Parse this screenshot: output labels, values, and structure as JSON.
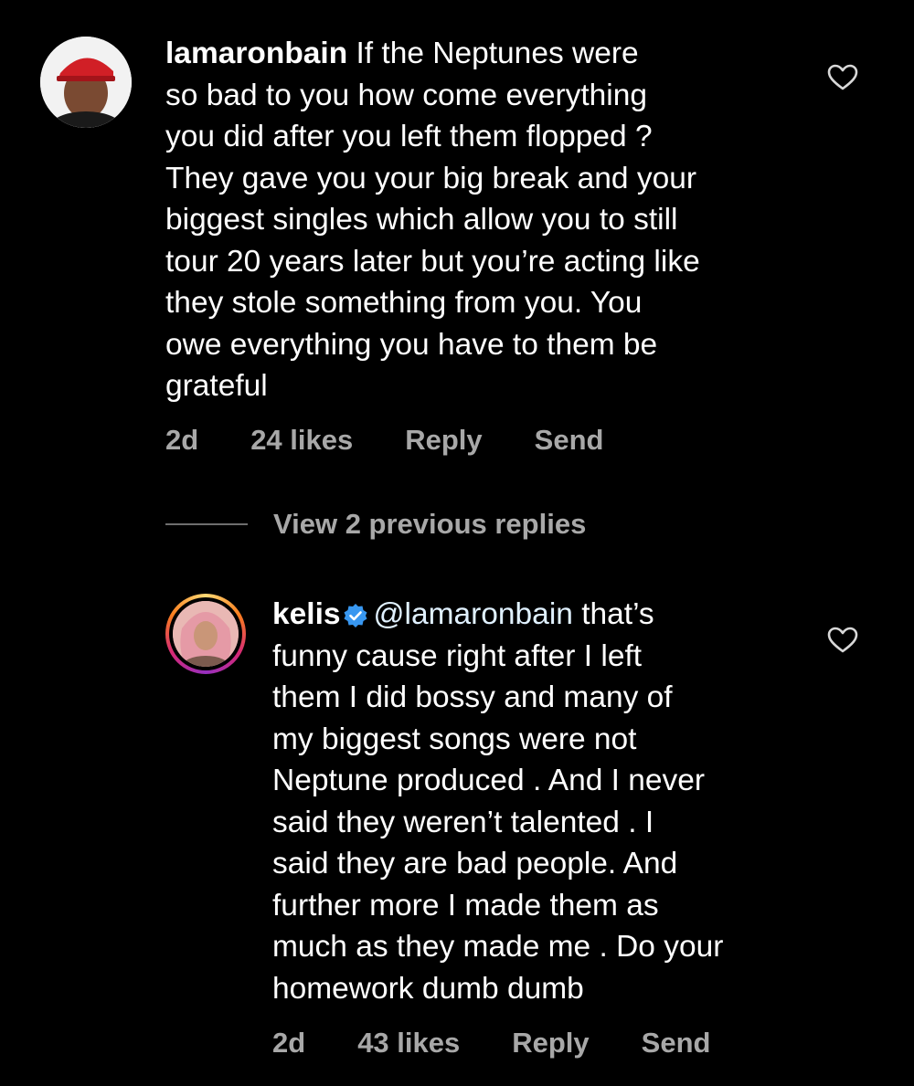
{
  "comments": [
    {
      "username": "lamaronbain",
      "verified": false,
      "text": " If the Neptunes were\nso bad to you how come everything\nyou did after you left them flopped ?\nThey gave you your big break and your\nbiggest singles which allow you to still\ntour 20 years later but you’re acting like\nthey stole something from you. You\nowe everything you have to them be\ngrateful",
      "time": "2d",
      "likes": "24 likes",
      "reply_label": "Reply",
      "send_label": "Send",
      "avatar_icon": "user-avatar-red-cap"
    },
    {
      "username": "kelis",
      "verified": true,
      "mention": "@lamaronbain",
      "text": " that’s\nfunny cause right after I left\nthem I did bossy and many of\nmy biggest songs were not\nNeptune produced . And I never\nsaid they weren’t talented . I\nsaid they are bad people. And\nfurther more I made them as\nmuch as they made me . Do your\nhomework dumb dumb",
      "time": "2d",
      "likes": "43 likes",
      "reply_label": "Reply",
      "send_label": "Send",
      "avatar_icon": "user-avatar-story-ring"
    }
  ],
  "view_replies_label": "View 2 previous replies",
  "colors": {
    "background": "#000000",
    "text": "#ffffff",
    "meta": "#a8a8a8",
    "verified": "#3897f0",
    "mention": "#e0f1ff"
  }
}
